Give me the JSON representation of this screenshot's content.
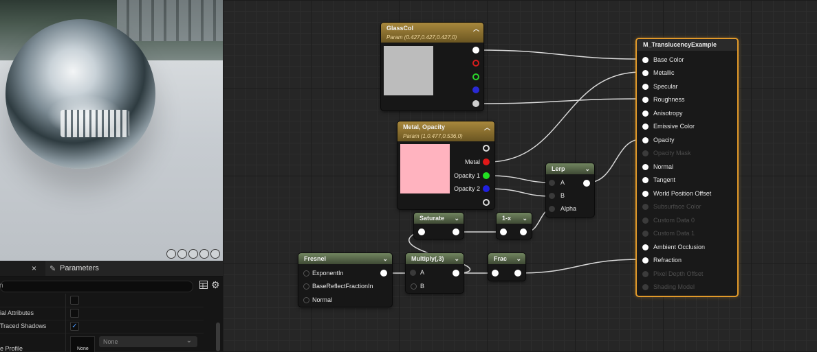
{
  "details": {
    "tab_close": "×",
    "tab_label": "Parameters",
    "search_placeholder": "n",
    "rows": [
      {
        "label": "",
        "checked": false
      },
      {
        "label": "ial Attributes",
        "checked": false
      },
      {
        "label": "Traced Shadows",
        "checked": true
      },
      {
        "label": "e Profile",
        "checked": null
      }
    ],
    "thumb_label": "None",
    "dropdown_value": "None"
  },
  "nodes": {
    "glasscol": {
      "title": "GlassCol",
      "subtitle": "Param (0.427,0.427,0.427,0)",
      "swatch": "#bcbcbc"
    },
    "metal_opacity": {
      "title": "Metal, Opacity",
      "subtitle": "Param (1,0.477,0.536,0)",
      "swatch": "#ffb3bf",
      "outputs": [
        "Metal",
        "Opacity 1",
        "Opacity 2"
      ]
    },
    "lerp": {
      "title": "Lerp",
      "inputs": [
        "A",
        "B",
        "Alpha"
      ]
    },
    "saturate": {
      "title": "Saturate"
    },
    "one_minus_x": {
      "title": "1-x"
    },
    "fresnel": {
      "title": "Fresnel",
      "inputs": [
        "ExponentIn",
        "BaseReflectFractionIn",
        "Normal"
      ]
    },
    "multiply": {
      "title": "Multiply(,3)",
      "inputs": [
        "A",
        "B"
      ]
    },
    "frac": {
      "title": "Frac"
    }
  },
  "result": {
    "title": "M_TranslucencyExample",
    "inputs": [
      {
        "label": "Base Color",
        "enabled": true
      },
      {
        "label": "Metallic",
        "enabled": true
      },
      {
        "label": "Specular",
        "enabled": true
      },
      {
        "label": "Roughness",
        "enabled": true
      },
      {
        "label": "Anisotropy",
        "enabled": true
      },
      {
        "label": "Emissive Color",
        "enabled": true
      },
      {
        "label": "Opacity",
        "enabled": true
      },
      {
        "label": "Opacity Mask",
        "enabled": false
      },
      {
        "label": "Normal",
        "enabled": true
      },
      {
        "label": "Tangent",
        "enabled": true
      },
      {
        "label": "World Position Offset",
        "enabled": true
      },
      {
        "label": "Subsurface Color",
        "enabled": false
      },
      {
        "label": "Custom Data 0",
        "enabled": false
      },
      {
        "label": "Custom Data 1",
        "enabled": false
      },
      {
        "label": "Ambient Occlusion",
        "enabled": true
      },
      {
        "label": "Refraction",
        "enabled": true
      },
      {
        "label": "Pixel Depth Offset",
        "enabled": false
      },
      {
        "label": "Shading Model",
        "enabled": false
      }
    ]
  },
  "colors": {
    "accent_border": "#e29a2a",
    "param_header": "#a8883c",
    "math_header": "#71855f",
    "wire": "#d9d9d9"
  }
}
